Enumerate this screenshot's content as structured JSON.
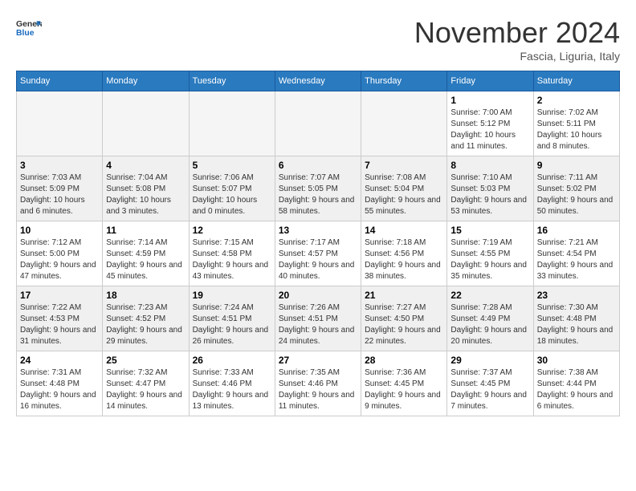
{
  "header": {
    "logo": {
      "general": "General",
      "blue": "Blue"
    },
    "title": "November 2024",
    "location": "Fascia, Liguria, Italy"
  },
  "weekdays": [
    "Sunday",
    "Monday",
    "Tuesday",
    "Wednesday",
    "Thursday",
    "Friday",
    "Saturday"
  ],
  "weeks": [
    [
      {
        "day": "",
        "empty": true
      },
      {
        "day": "",
        "empty": true
      },
      {
        "day": "",
        "empty": true
      },
      {
        "day": "",
        "empty": true
      },
      {
        "day": "",
        "empty": true
      },
      {
        "day": "1",
        "sunrise": "7:00 AM",
        "sunset": "5:12 PM",
        "daylight": "10 hours and 11 minutes."
      },
      {
        "day": "2",
        "sunrise": "7:02 AM",
        "sunset": "5:11 PM",
        "daylight": "10 hours and 8 minutes."
      }
    ],
    [
      {
        "day": "3",
        "sunrise": "7:03 AM",
        "sunset": "5:09 PM",
        "daylight": "10 hours and 6 minutes."
      },
      {
        "day": "4",
        "sunrise": "7:04 AM",
        "sunset": "5:08 PM",
        "daylight": "10 hours and 3 minutes."
      },
      {
        "day": "5",
        "sunrise": "7:06 AM",
        "sunset": "5:07 PM",
        "daylight": "10 hours and 0 minutes."
      },
      {
        "day": "6",
        "sunrise": "7:07 AM",
        "sunset": "5:05 PM",
        "daylight": "9 hours and 58 minutes."
      },
      {
        "day": "7",
        "sunrise": "7:08 AM",
        "sunset": "5:04 PM",
        "daylight": "9 hours and 55 minutes."
      },
      {
        "day": "8",
        "sunrise": "7:10 AM",
        "sunset": "5:03 PM",
        "daylight": "9 hours and 53 minutes."
      },
      {
        "day": "9",
        "sunrise": "7:11 AM",
        "sunset": "5:02 PM",
        "daylight": "9 hours and 50 minutes."
      }
    ],
    [
      {
        "day": "10",
        "sunrise": "7:12 AM",
        "sunset": "5:00 PM",
        "daylight": "9 hours and 47 minutes."
      },
      {
        "day": "11",
        "sunrise": "7:14 AM",
        "sunset": "4:59 PM",
        "daylight": "9 hours and 45 minutes."
      },
      {
        "day": "12",
        "sunrise": "7:15 AM",
        "sunset": "4:58 PM",
        "daylight": "9 hours and 43 minutes."
      },
      {
        "day": "13",
        "sunrise": "7:17 AM",
        "sunset": "4:57 PM",
        "daylight": "9 hours and 40 minutes."
      },
      {
        "day": "14",
        "sunrise": "7:18 AM",
        "sunset": "4:56 PM",
        "daylight": "9 hours and 38 minutes."
      },
      {
        "day": "15",
        "sunrise": "7:19 AM",
        "sunset": "4:55 PM",
        "daylight": "9 hours and 35 minutes."
      },
      {
        "day": "16",
        "sunrise": "7:21 AM",
        "sunset": "4:54 PM",
        "daylight": "9 hours and 33 minutes."
      }
    ],
    [
      {
        "day": "17",
        "sunrise": "7:22 AM",
        "sunset": "4:53 PM",
        "daylight": "9 hours and 31 minutes."
      },
      {
        "day": "18",
        "sunrise": "7:23 AM",
        "sunset": "4:52 PM",
        "daylight": "9 hours and 29 minutes."
      },
      {
        "day": "19",
        "sunrise": "7:24 AM",
        "sunset": "4:51 PM",
        "daylight": "9 hours and 26 minutes."
      },
      {
        "day": "20",
        "sunrise": "7:26 AM",
        "sunset": "4:51 PM",
        "daylight": "9 hours and 24 minutes."
      },
      {
        "day": "21",
        "sunrise": "7:27 AM",
        "sunset": "4:50 PM",
        "daylight": "9 hours and 22 minutes."
      },
      {
        "day": "22",
        "sunrise": "7:28 AM",
        "sunset": "4:49 PM",
        "daylight": "9 hours and 20 minutes."
      },
      {
        "day": "23",
        "sunrise": "7:30 AM",
        "sunset": "4:48 PM",
        "daylight": "9 hours and 18 minutes."
      }
    ],
    [
      {
        "day": "24",
        "sunrise": "7:31 AM",
        "sunset": "4:48 PM",
        "daylight": "9 hours and 16 minutes."
      },
      {
        "day": "25",
        "sunrise": "7:32 AM",
        "sunset": "4:47 PM",
        "daylight": "9 hours and 14 minutes."
      },
      {
        "day": "26",
        "sunrise": "7:33 AM",
        "sunset": "4:46 PM",
        "daylight": "9 hours and 13 minutes."
      },
      {
        "day": "27",
        "sunrise": "7:35 AM",
        "sunset": "4:46 PM",
        "daylight": "9 hours and 11 minutes."
      },
      {
        "day": "28",
        "sunrise": "7:36 AM",
        "sunset": "4:45 PM",
        "daylight": "9 hours and 9 minutes."
      },
      {
        "day": "29",
        "sunrise": "7:37 AM",
        "sunset": "4:45 PM",
        "daylight": "9 hours and 7 minutes."
      },
      {
        "day": "30",
        "sunrise": "7:38 AM",
        "sunset": "4:44 PM",
        "daylight": "9 hours and 6 minutes."
      }
    ]
  ]
}
